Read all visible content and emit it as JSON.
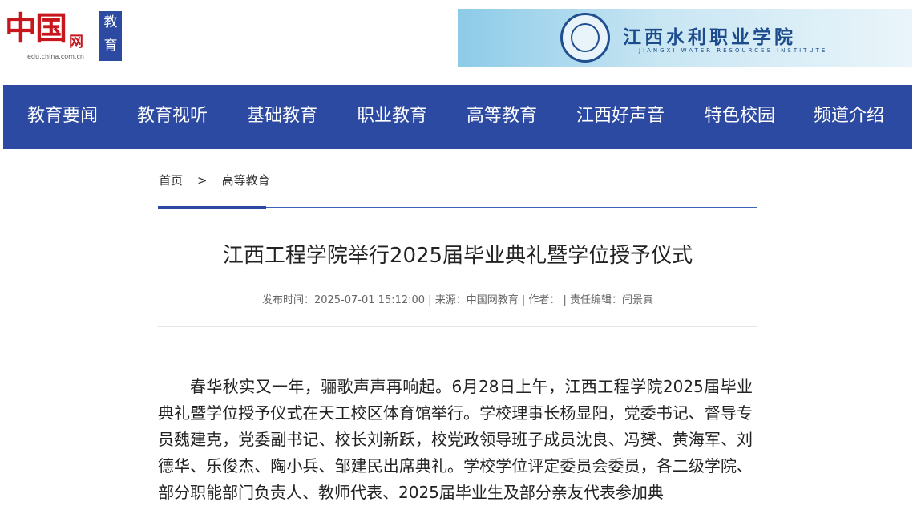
{
  "header": {
    "logo_text": "中国",
    "logo_wang": "网",
    "logo_url": "edu.china.com.cn",
    "logo_badge": "教育",
    "banner_title": "江西水利职业学院",
    "banner_subtitle": "JIANGXI WATER RESOURCES INSTITUTE"
  },
  "nav": {
    "items": [
      "教育要闻",
      "教育视听",
      "基础教育",
      "职业教育",
      "高等教育",
      "江西好声音",
      "特色校园",
      "频道介绍"
    ]
  },
  "breadcrumb": {
    "home": "首页",
    "separator": ">",
    "current": "高等教育"
  },
  "article": {
    "title": "江西工程学院举行2025届毕业典礼暨学位授予仪式",
    "meta": "发布时间：2025-07-01 15:12:00 | 来源：中国网教育 | 作者：  | 责任编辑：闫景真",
    "body": "春华秋实又一年，骊歌声声再响起。6月28日上午，江西工程学院2025届毕业典礼暨学位授予仪式在天工校区体育馆举行。学校理事长杨显阳，党委书记、督导专员魏建克，党委副书记、校长刘新跃，校党政领导班子成员沈良、冯赟、黄海军、刘德华、乐俊杰、陶小兵、邹建民出席典礼。学校学位评定委员会委员，各二级学院、部分职能部门负责人、教师代表、2025届毕业生及部分亲友代表参加典"
  },
  "colors": {
    "nav_bg": "#2c4aa1",
    "logo_red": "#c8161d",
    "rule_blue": "#3b63b8"
  }
}
